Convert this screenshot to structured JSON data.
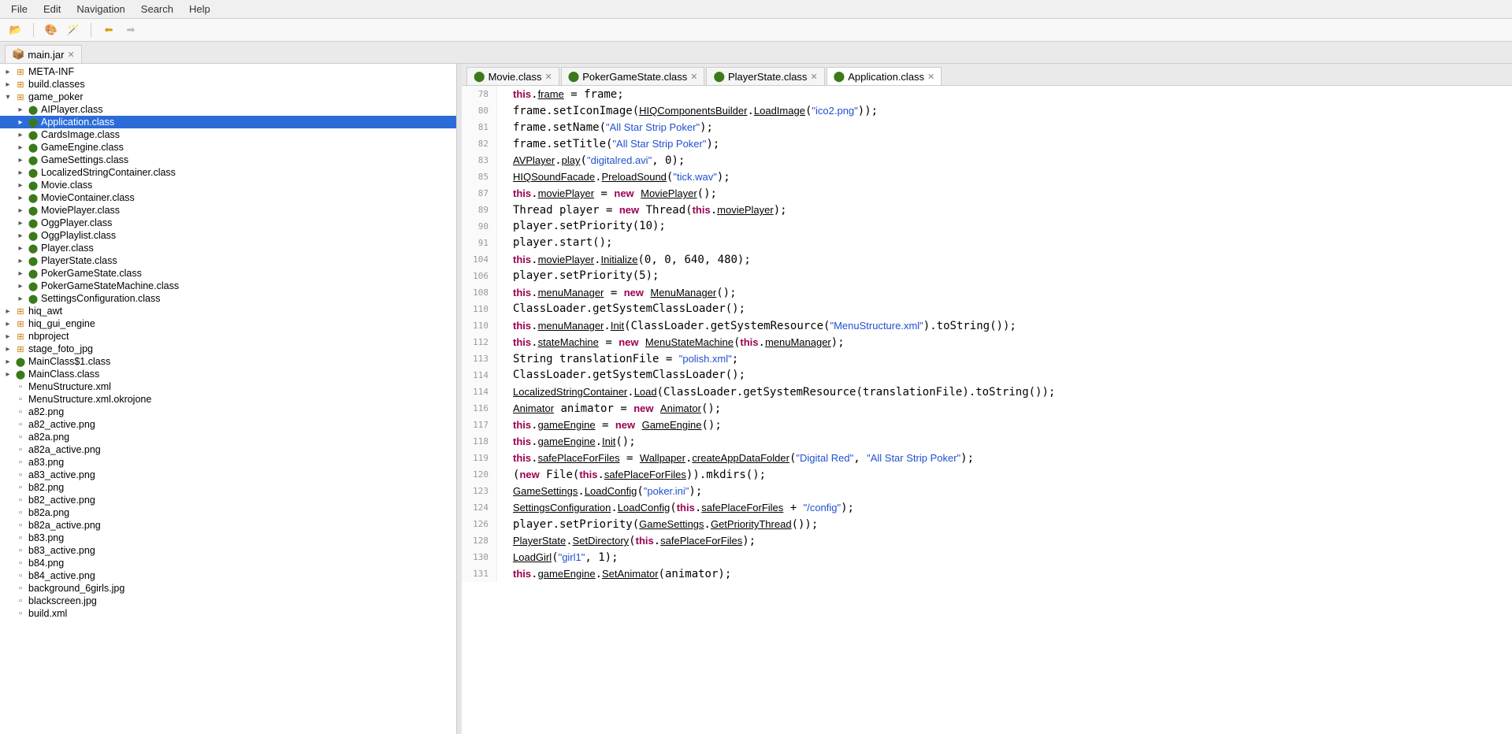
{
  "menubar": [
    "File",
    "Edit",
    "Navigation",
    "Search",
    "Help"
  ],
  "topTab": {
    "label": "main.jar"
  },
  "tree": [
    {
      "depth": 0,
      "arrow": "▸",
      "ico": "pkg",
      "label": "META-INF"
    },
    {
      "depth": 0,
      "arrow": "▸",
      "ico": "pkg",
      "label": "build.classes"
    },
    {
      "depth": 0,
      "arrow": "▾",
      "ico": "pkg",
      "label": "game_poker"
    },
    {
      "depth": 1,
      "arrow": "▸",
      "ico": "class",
      "label": "AIPlayer.class"
    },
    {
      "depth": 1,
      "arrow": "▸",
      "ico": "class",
      "label": "Application.class",
      "selected": true
    },
    {
      "depth": 1,
      "arrow": "▸",
      "ico": "class",
      "label": "CardsImage.class"
    },
    {
      "depth": 1,
      "arrow": "▸",
      "ico": "class",
      "label": "GameEngine.class"
    },
    {
      "depth": 1,
      "arrow": "▸",
      "ico": "class",
      "label": "GameSettings.class"
    },
    {
      "depth": 1,
      "arrow": "▸",
      "ico": "class",
      "label": "LocalizedStringContainer.class"
    },
    {
      "depth": 1,
      "arrow": "▸",
      "ico": "class",
      "label": "Movie.class"
    },
    {
      "depth": 1,
      "arrow": "▸",
      "ico": "class",
      "label": "MovieContainer.class"
    },
    {
      "depth": 1,
      "arrow": "▸",
      "ico": "class",
      "label": "MoviePlayer.class"
    },
    {
      "depth": 1,
      "arrow": "▸",
      "ico": "class",
      "label": "OggPlayer.class"
    },
    {
      "depth": 1,
      "arrow": "▸",
      "ico": "class",
      "label": "OggPlaylist.class"
    },
    {
      "depth": 1,
      "arrow": "▸",
      "ico": "class",
      "label": "Player.class"
    },
    {
      "depth": 1,
      "arrow": "▸",
      "ico": "class",
      "label": "PlayerState.class"
    },
    {
      "depth": 1,
      "arrow": "▸",
      "ico": "class",
      "label": "PokerGameState.class"
    },
    {
      "depth": 1,
      "arrow": "▸",
      "ico": "class",
      "label": "PokerGameStateMachine.class"
    },
    {
      "depth": 1,
      "arrow": "▸",
      "ico": "class",
      "label": "SettingsConfiguration.class"
    },
    {
      "depth": 0,
      "arrow": "▸",
      "ico": "pkg",
      "label": "hiq_awt"
    },
    {
      "depth": 0,
      "arrow": "▸",
      "ico": "pkg",
      "label": "hiq_gui_engine"
    },
    {
      "depth": 0,
      "arrow": "▸",
      "ico": "pkg",
      "label": "nbproject"
    },
    {
      "depth": 0,
      "arrow": "▸",
      "ico": "pkg",
      "label": "stage_foto_jpg"
    },
    {
      "depth": 0,
      "arrow": "▸",
      "ico": "class",
      "label": "MainClass$1.class"
    },
    {
      "depth": 0,
      "arrow": "▸",
      "ico": "class",
      "label": "MainClass.class"
    },
    {
      "depth": 0,
      "arrow": "",
      "ico": "file",
      "label": "MenuStructure.xml"
    },
    {
      "depth": 0,
      "arrow": "",
      "ico": "file",
      "label": "MenuStructure.xml.okrojone"
    },
    {
      "depth": 0,
      "arrow": "",
      "ico": "file",
      "label": "a82.png"
    },
    {
      "depth": 0,
      "arrow": "",
      "ico": "file",
      "label": "a82_active.png"
    },
    {
      "depth": 0,
      "arrow": "",
      "ico": "file",
      "label": "a82a.png"
    },
    {
      "depth": 0,
      "arrow": "",
      "ico": "file",
      "label": "a82a_active.png"
    },
    {
      "depth": 0,
      "arrow": "",
      "ico": "file",
      "label": "a83.png"
    },
    {
      "depth": 0,
      "arrow": "",
      "ico": "file",
      "label": "a83_active.png"
    },
    {
      "depth": 0,
      "arrow": "",
      "ico": "file",
      "label": "b82.png"
    },
    {
      "depth": 0,
      "arrow": "",
      "ico": "file",
      "label": "b82_active.png"
    },
    {
      "depth": 0,
      "arrow": "",
      "ico": "file",
      "label": "b82a.png"
    },
    {
      "depth": 0,
      "arrow": "",
      "ico": "file",
      "label": "b82a_active.png"
    },
    {
      "depth": 0,
      "arrow": "",
      "ico": "file",
      "label": "b83.png"
    },
    {
      "depth": 0,
      "arrow": "",
      "ico": "file",
      "label": "b83_active.png"
    },
    {
      "depth": 0,
      "arrow": "",
      "ico": "file",
      "label": "b84.png"
    },
    {
      "depth": 0,
      "arrow": "",
      "ico": "file",
      "label": "b84_active.png"
    },
    {
      "depth": 0,
      "arrow": "",
      "ico": "file",
      "label": "background_6girls.jpg"
    },
    {
      "depth": 0,
      "arrow": "",
      "ico": "file",
      "label": "blackscreen.jpg"
    },
    {
      "depth": 0,
      "arrow": "",
      "ico": "file",
      "label": "build.xml"
    }
  ],
  "editorTabs": [
    {
      "label": "Movie.class",
      "active": false
    },
    {
      "label": "PokerGameState.class",
      "active": false
    },
    {
      "label": "PlayerState.class",
      "active": false
    },
    {
      "label": "Application.class",
      "active": true
    }
  ],
  "code": [
    {
      "ln": 78,
      "html": "<span class='kw'>this</span>.<span class='udl'>frame</span> = frame;"
    },
    {
      "ln": 80,
      "html": "frame.setIconImage(<span class='udl'>HIQComponentsBuilder</span>.<span class='udl'>LoadImage</span>(<span class='str'>\"ico2.png\"</span>));"
    },
    {
      "ln": 81,
      "html": "frame.setName(<span class='str'>\"All Star Strip Poker\"</span>);"
    },
    {
      "ln": 82,
      "html": "frame.setTitle(<span class='str'>\"All Star Strip Poker\"</span>);"
    },
    {
      "ln": 83,
      "html": "<span class='udl'>AVPlayer</span>.<span class='udl'>play</span>(<span class='str'>\"digitalred.avi\"</span>, 0);"
    },
    {
      "ln": 85,
      "html": "<span class='udl'>HIQSoundFacade</span>.<span class='udl'>PreloadSound</span>(<span class='str'>\"tick.wav\"</span>);"
    },
    {
      "ln": 87,
      "html": "<span class='kw'>this</span>.<span class='udl'>moviePlayer</span> = <span class='kw'>new</span> <span class='udl'>MoviePlayer</span>();"
    },
    {
      "ln": 89,
      "html": "Thread player = <span class='kw'>new</span> Thread(<span class='kw'>this</span>.<span class='udl'>moviePlayer</span>);"
    },
    {
      "ln": 90,
      "html": "player.setPriority(10);"
    },
    {
      "ln": 91,
      "html": "player.start();"
    },
    {
      "ln": 104,
      "html": "<span class='kw'>this</span>.<span class='udl'>moviePlayer</span>.<span class='udl'>Initialize</span>(0, 0, 640, 480);"
    },
    {
      "ln": 106,
      "html": "player.setPriority(5);"
    },
    {
      "ln": 108,
      "html": "<span class='kw'>this</span>.<span class='udl'>menuManager</span> = <span class='kw'>new</span> <span class='udl'>MenuManager</span>();"
    },
    {
      "ln": 110,
      "html": "ClassLoader.getSystemClassLoader();"
    },
    {
      "ln": 110,
      "html": "<span class='kw'>this</span>.<span class='udl'>menuManager</span>.<span class='udl'>Init</span>(ClassLoader.getSystemResource(<span class='str'>\"MenuStructure.xml\"</span>).toString());"
    },
    {
      "ln": 112,
      "html": "<span class='kw'>this</span>.<span class='udl'>stateMachine</span> = <span class='kw'>new</span> <span class='udl'>MenuStateMachine</span>(<span class='kw'>this</span>.<span class='udl'>menuManager</span>);"
    },
    {
      "ln": 113,
      "html": "String translationFile = <span class='str'>\"polish.xml\"</span>;"
    },
    {
      "ln": 114,
      "html": "ClassLoader.getSystemClassLoader();"
    },
    {
      "ln": 114,
      "html": "<span class='udl'>LocalizedStringContainer</span>.<span class='udl'>Load</span>(ClassLoader.getSystemResource(translationFile).toString());"
    },
    {
      "ln": 116,
      "html": "<span class='udl'>Animator</span> animator = <span class='kw'>new</span> <span class='udl'>Animator</span>();"
    },
    {
      "ln": 117,
      "html": "<span class='kw'>this</span>.<span class='udl'>gameEngine</span> = <span class='kw'>new</span> <span class='udl'>GameEngine</span>();"
    },
    {
      "ln": 118,
      "html": "<span class='kw'>this</span>.<span class='udl'>gameEngine</span>.<span class='udl'>Init</span>();"
    },
    {
      "ln": 119,
      "html": "<span class='kw'>this</span>.<span class='udl'>safePlaceForFiles</span> = <span class='udl'>Wallpaper</span>.<span class='udl'>createAppDataFolder</span>(<span class='str'>\"Digital Red\"</span>, <span class='str'>\"All Star Strip Poker\"</span>);"
    },
    {
      "ln": 120,
      "html": "(<span class='kw'>new</span> File(<span class='kw'>this</span>.<span class='udl'>safePlaceForFiles</span>)).mkdirs();"
    },
    {
      "ln": 123,
      "html": "<span class='udl'>GameSettings</span>.<span class='udl'>LoadConfig</span>(<span class='str'>\"poker.ini\"</span>);"
    },
    {
      "ln": 124,
      "html": "<span class='udl'>SettingsConfiguration</span>.<span class='udl'>LoadConfig</span>(<span class='kw'>this</span>.<span class='udl'>safePlaceForFiles</span> + <span class='str'>\"/config\"</span>);"
    },
    {
      "ln": 126,
      "html": "player.setPriority(<span class='udl'>GameSettings</span>.<span class='udl'>GetPriorityThread</span>());"
    },
    {
      "ln": 128,
      "html": "<span class='udl'>PlayerState</span>.<span class='udl'>SetDirectory</span>(<span class='kw'>this</span>.<span class='udl'>safePlaceForFiles</span>);"
    },
    {
      "ln": 130,
      "html": "<span class='udl'>LoadGirl</span>(<span class='str'>\"girl1\"</span>, 1);"
    },
    {
      "ln": 131,
      "html": "<span class='kw'>this</span>.<span class='udl'>gameEngine</span>.<span class='udl'>SetAnimator</span>(animator);"
    }
  ]
}
